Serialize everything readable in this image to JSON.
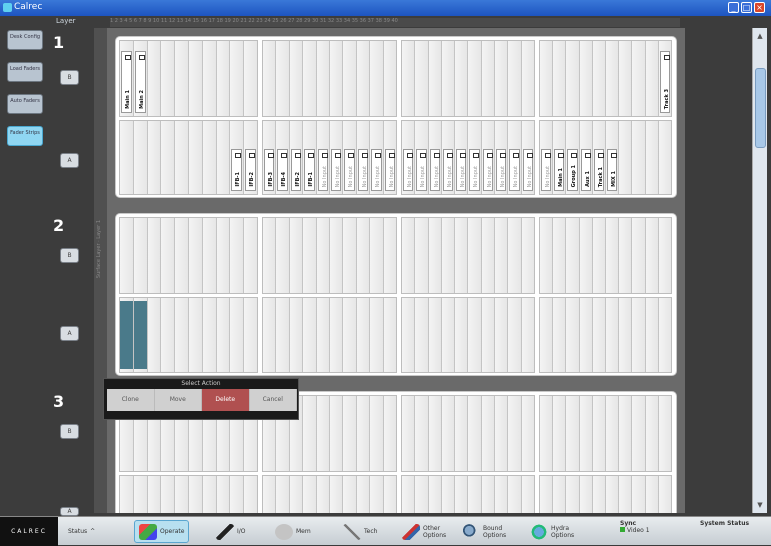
{
  "window": {
    "title": "Calrec"
  },
  "sidebar": {
    "items": [
      {
        "label": "Desk Config",
        "active": false
      },
      {
        "label": "Load Faders",
        "active": false
      },
      {
        "label": "Auto Faders",
        "active": false
      },
      {
        "label": "Fader Strips",
        "active": true
      }
    ]
  },
  "layer_header": "Layer",
  "strip_col_label": "Surface Layer · Layer 1",
  "ruler": "1 2 3 4 5 6 7 8 9 10 11 12 13 14 15 16 17 18 19 20 21 22 23 24 25 26 27 28 29 30 31 32 33 34 35 36 37 38 39 40",
  "layers": [
    {
      "number": "1",
      "btn_b": "B",
      "btn_a": "A",
      "row_a": {
        "labels": [
          "Main 1",
          "Main 2",
          "",
          "",
          "",
          "",
          "",
          "",
          "",
          "",
          "",
          "",
          "",
          "",
          "",
          "",
          "",
          "",
          "",
          "",
          "",
          "",
          "",
          "",
          "",
          "",
          "",
          "",
          "",
          "",
          "",
          "",
          "",
          "",
          "",
          "",
          "",
          "",
          "",
          "Track 3"
        ]
      },
      "row_b": {
        "labels": [
          "",
          "",
          "",
          "",
          "",
          "",
          "",
          "",
          "IFB-1",
          "IFB-2",
          "IFB-3",
          "IFB-4",
          "IFB-2",
          "IFB-1",
          "No Input",
          "No Input",
          "No Input",
          "No Input",
          "No Input",
          "No Input",
          "No Input",
          "No Input",
          "No Input",
          "No Input",
          "No Input",
          "No Input",
          "No Input",
          "No Input",
          "No Input",
          "No Input",
          "No Input",
          "Main 1",
          "Group 1",
          "Aux 1",
          "Track 1",
          "MIX 1"
        ]
      }
    },
    {
      "number": "2",
      "btn_b": "B",
      "btn_a": "A"
    },
    {
      "number": "3",
      "btn_b": "B",
      "btn_a": "A"
    }
  ],
  "select_action": {
    "title": "Select Action",
    "buttons": [
      {
        "label": "Clone",
        "active": false
      },
      {
        "label": "Move",
        "active": false
      },
      {
        "label": "Delete",
        "active": true
      },
      {
        "label": "Cancel",
        "active": false
      }
    ]
  },
  "toolbar": {
    "brand": "CALREC",
    "status_label": "Status",
    "buttons": [
      {
        "label": "Operate",
        "icon": "people-icon",
        "active": true
      },
      {
        "label": "I/O",
        "icon": "pen-icon",
        "active": false
      },
      {
        "label": "Mem",
        "icon": "disk-icon",
        "active": false
      },
      {
        "label": "Tech",
        "icon": "tools-icon",
        "active": false
      },
      {
        "label": "Other Options",
        "icon": "wrench-icon",
        "active": false
      },
      {
        "label": "Bound Options",
        "icon": "magnifier-icon",
        "active": false
      },
      {
        "label": "Hydra Options",
        "icon": "globe-icon",
        "active": false
      }
    ],
    "sync_label": "Sync",
    "sync_value": "Video 1",
    "system_status": "System Status"
  },
  "colors": {
    "accent": "#8fd6f2",
    "delete": "#b05050",
    "selected_strip": "#4a7a8a"
  }
}
